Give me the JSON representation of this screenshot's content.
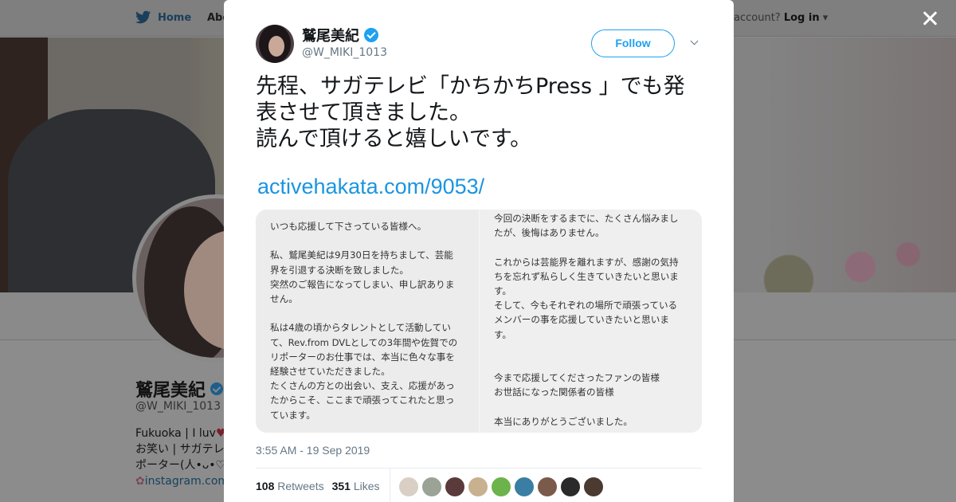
{
  "nav": {
    "home_label": "Home",
    "about_label": "Abo",
    "account_prompt": "account?",
    "login_label": "Log in"
  },
  "profile": {
    "name": "鷲尾美紀",
    "handle": "@W_MIKI_1013",
    "bio_line1": "Fukuoka | I luv",
    "bio_line2": "お笑い | サガテレ",
    "bio_line3": "ポーター(人•ᴗ•♡)",
    "bio_link": "instagram.com"
  },
  "tweet": {
    "author_name": "鷲尾美紀",
    "author_handle": "@W_MIKI_1013",
    "follow_label": "Follow",
    "text": "先程、サガテレビ「かちかちPress 」でも発\n表させて頂きました。\n読んで頂けると嬉しいです。",
    "link": "activehakata.com/9053/",
    "media_left": "いつも応援して下さっている皆様へ。\n\n私、鷲尾美紀は9月30日を持ちまして、芸能\n界を引退する決断を致しました。\n突然のご報告になってしまい、申し訳ありま\nせん。\n\n私は4歳の頃からタレントとして活動してい\nて、Rev.from DVLとしての3年間や佐賀での\nリポーターのお仕事では、本当に色々な事を\n経験させていただきました。\nたくさんの方との出会い、支え、応援があっ\nたからこそ、ここまで頑張ってこれたと思っ\nています。",
    "media_right": "今回の決断をするまでに、たくさん悩みまし\nたが、後悔はありません。\n\nこれからは芸能界を離れますが、感謝の気持\nちを忘れず私らしく生きていきたいと思いま\nす。\nそして、今もそれぞれの場所で頑張っている\nメンバーの事を応援していきたいと思いま\nす。\n\n\n今まで応援してくださったファンの皆様\nお世話になった関係者の皆様\n\n本当にありがとうございました。",
    "timestamp": "3:55 AM - 19 Sep 2019",
    "retweets_count": "108",
    "retweets_label": "Retweets",
    "likes_count": "351",
    "likes_label": "Likes"
  },
  "colors": {
    "accent": "#1da1f2",
    "link": "#1b95e0",
    "overlay": "#8c8c8c"
  },
  "icons": {
    "close": "close-icon",
    "verified": "verified-badge-icon",
    "caret": "chevron-down-icon",
    "bird": "twitter-bird-icon"
  }
}
